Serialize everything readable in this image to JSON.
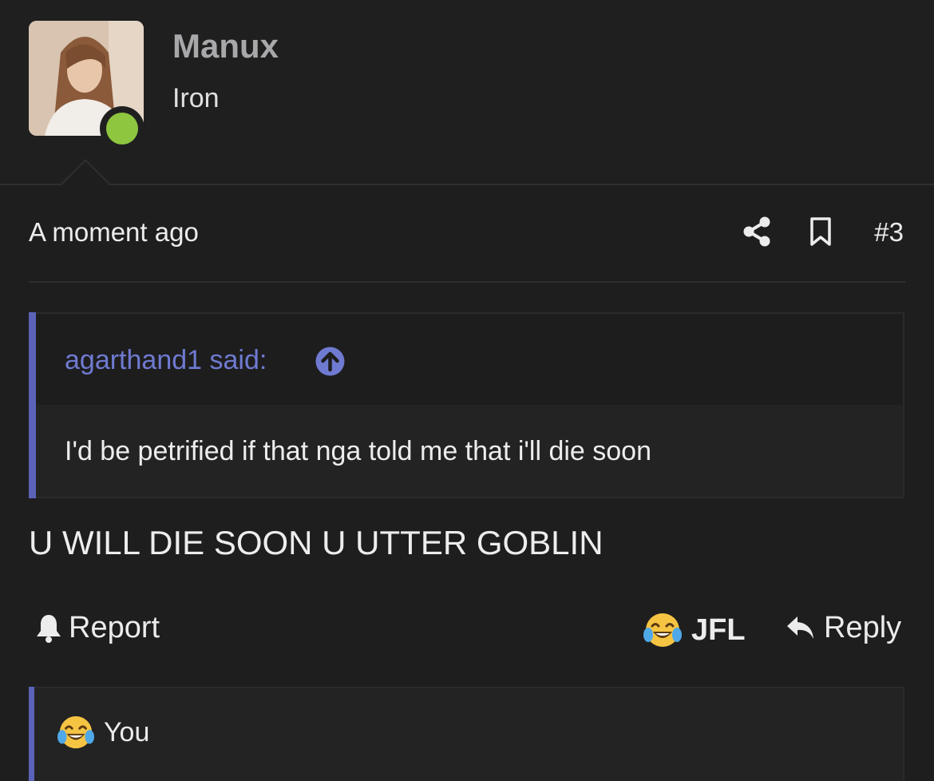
{
  "user": {
    "name": "Manux",
    "title": "Iron",
    "online": true,
    "status_color": "#8ec63f"
  },
  "post": {
    "timestamp": "A moment ago",
    "number": "#3",
    "icons": [
      "share-icon",
      "bookmark-icon"
    ]
  },
  "quote": {
    "author": "agarthand1 said:",
    "text": "I'd be petrified if that nga told me that i'll die soon",
    "accent": "#5b63b8"
  },
  "message": "U WILL DIE SOON U UTTER GOBLIN",
  "actions": {
    "report": "Report",
    "reaction": "JFL",
    "reply": "Reply"
  },
  "reactions": {
    "label": "You"
  }
}
